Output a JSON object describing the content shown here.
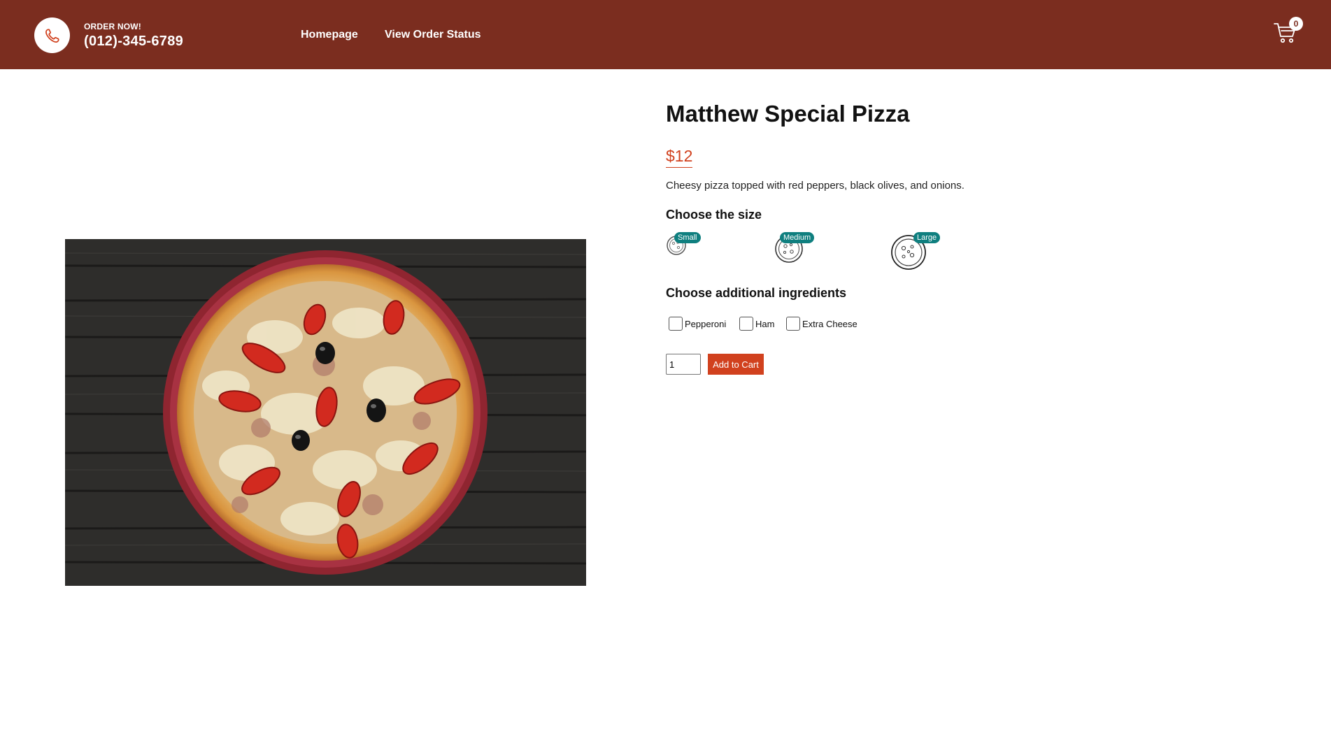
{
  "header": {
    "order_now": "ORDER NOW!",
    "phone": "(012)-345-6789",
    "nav": {
      "homepage": "Homepage",
      "order_status": "View Order Status"
    },
    "cart_count": "0",
    "bg_color": "#7b2d1f"
  },
  "product": {
    "title": "Matthew Special Pizza",
    "price": "$12",
    "description": "Cheesy pizza topped with red peppers, black olives, and onions.",
    "size_heading": "Choose the size",
    "sizes": [
      "Small",
      "Medium",
      "Large"
    ],
    "ingredients_heading": "Choose additional ingredients",
    "ingredients": [
      "Pepperoni",
      "Ham",
      "Extra Cheese"
    ],
    "quantity": "1",
    "add_to_cart": "Add to Cart",
    "accent_color": "#d1411e",
    "badge_color": "#0f7f7f"
  }
}
